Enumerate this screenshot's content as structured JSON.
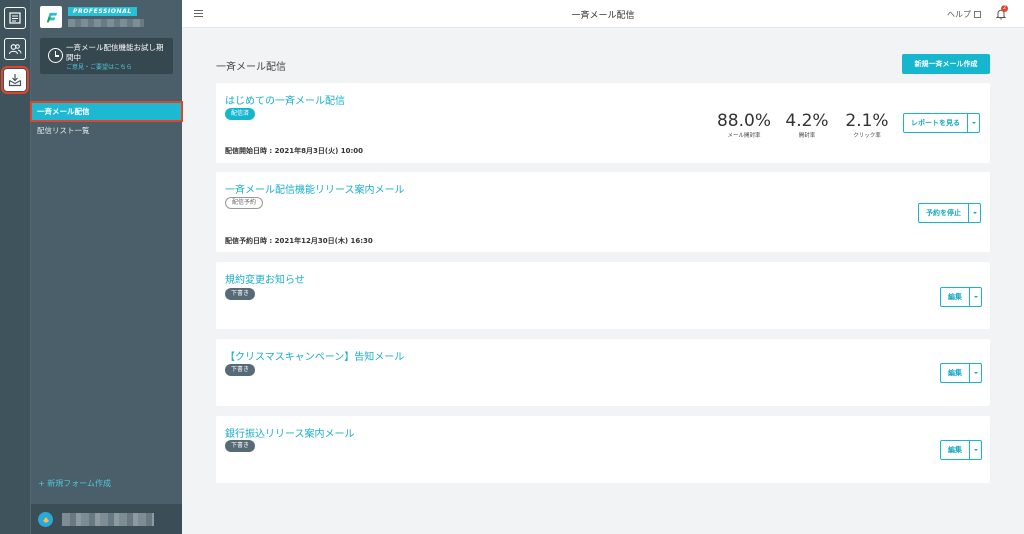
{
  "header": {
    "title": "一斉メール配信",
    "help_label": "ヘルプ",
    "notification_count": "2"
  },
  "sidebar": {
    "plan": "PROFESSIONAL",
    "trial": {
      "text": "一斉メール配信機能お試し期間中",
      "link": "ご意見・ご要望はこちら"
    },
    "items": [
      {
        "label": "一斉メール配信",
        "active": true
      },
      {
        "label": "配信リスト一覧",
        "active": false
      }
    ],
    "new_form": "+ 新規フォーム作成"
  },
  "main": {
    "heading": "一斉メール配信",
    "new_button": "新規一斉メール作成",
    "cards": [
      {
        "title": "はじめての一斉メール配信",
        "status": "配信済",
        "date": "配信開始日時 : 2021年8月3日(火) 10:00",
        "stats": [
          {
            "value": "88.0%",
            "label": "メール開封率"
          },
          {
            "value": "4.2%",
            "label": "開封率"
          },
          {
            "value": "2.1%",
            "label": "クリック率"
          }
        ],
        "action": "レポートを見る"
      },
      {
        "title": "一斉メール配信機能リリース案内メール",
        "status": "配信予約",
        "date": "配信予約日時 : 2021年12月30日(木) 16:30",
        "action": "予約を停止"
      },
      {
        "title": "規約変更お知らせ",
        "status": "下書き",
        "action": "編集"
      },
      {
        "title": "【クリスマスキャンペーン】告知メール",
        "status": "下書き",
        "action": "編集"
      },
      {
        "title": "銀行振込リリース案内メール",
        "status": "下書き",
        "action": "編集"
      }
    ]
  },
  "colors": {
    "accent": "#17b6cf",
    "sidebar": "#4a5f69",
    "rail": "#3f535d",
    "highlight": "#e0452a"
  },
  "icons": [
    "form-list-icon",
    "users-icon",
    "mail-download-icon",
    "clock-icon",
    "bell-icon",
    "external-link-icon",
    "menu-icon"
  ]
}
